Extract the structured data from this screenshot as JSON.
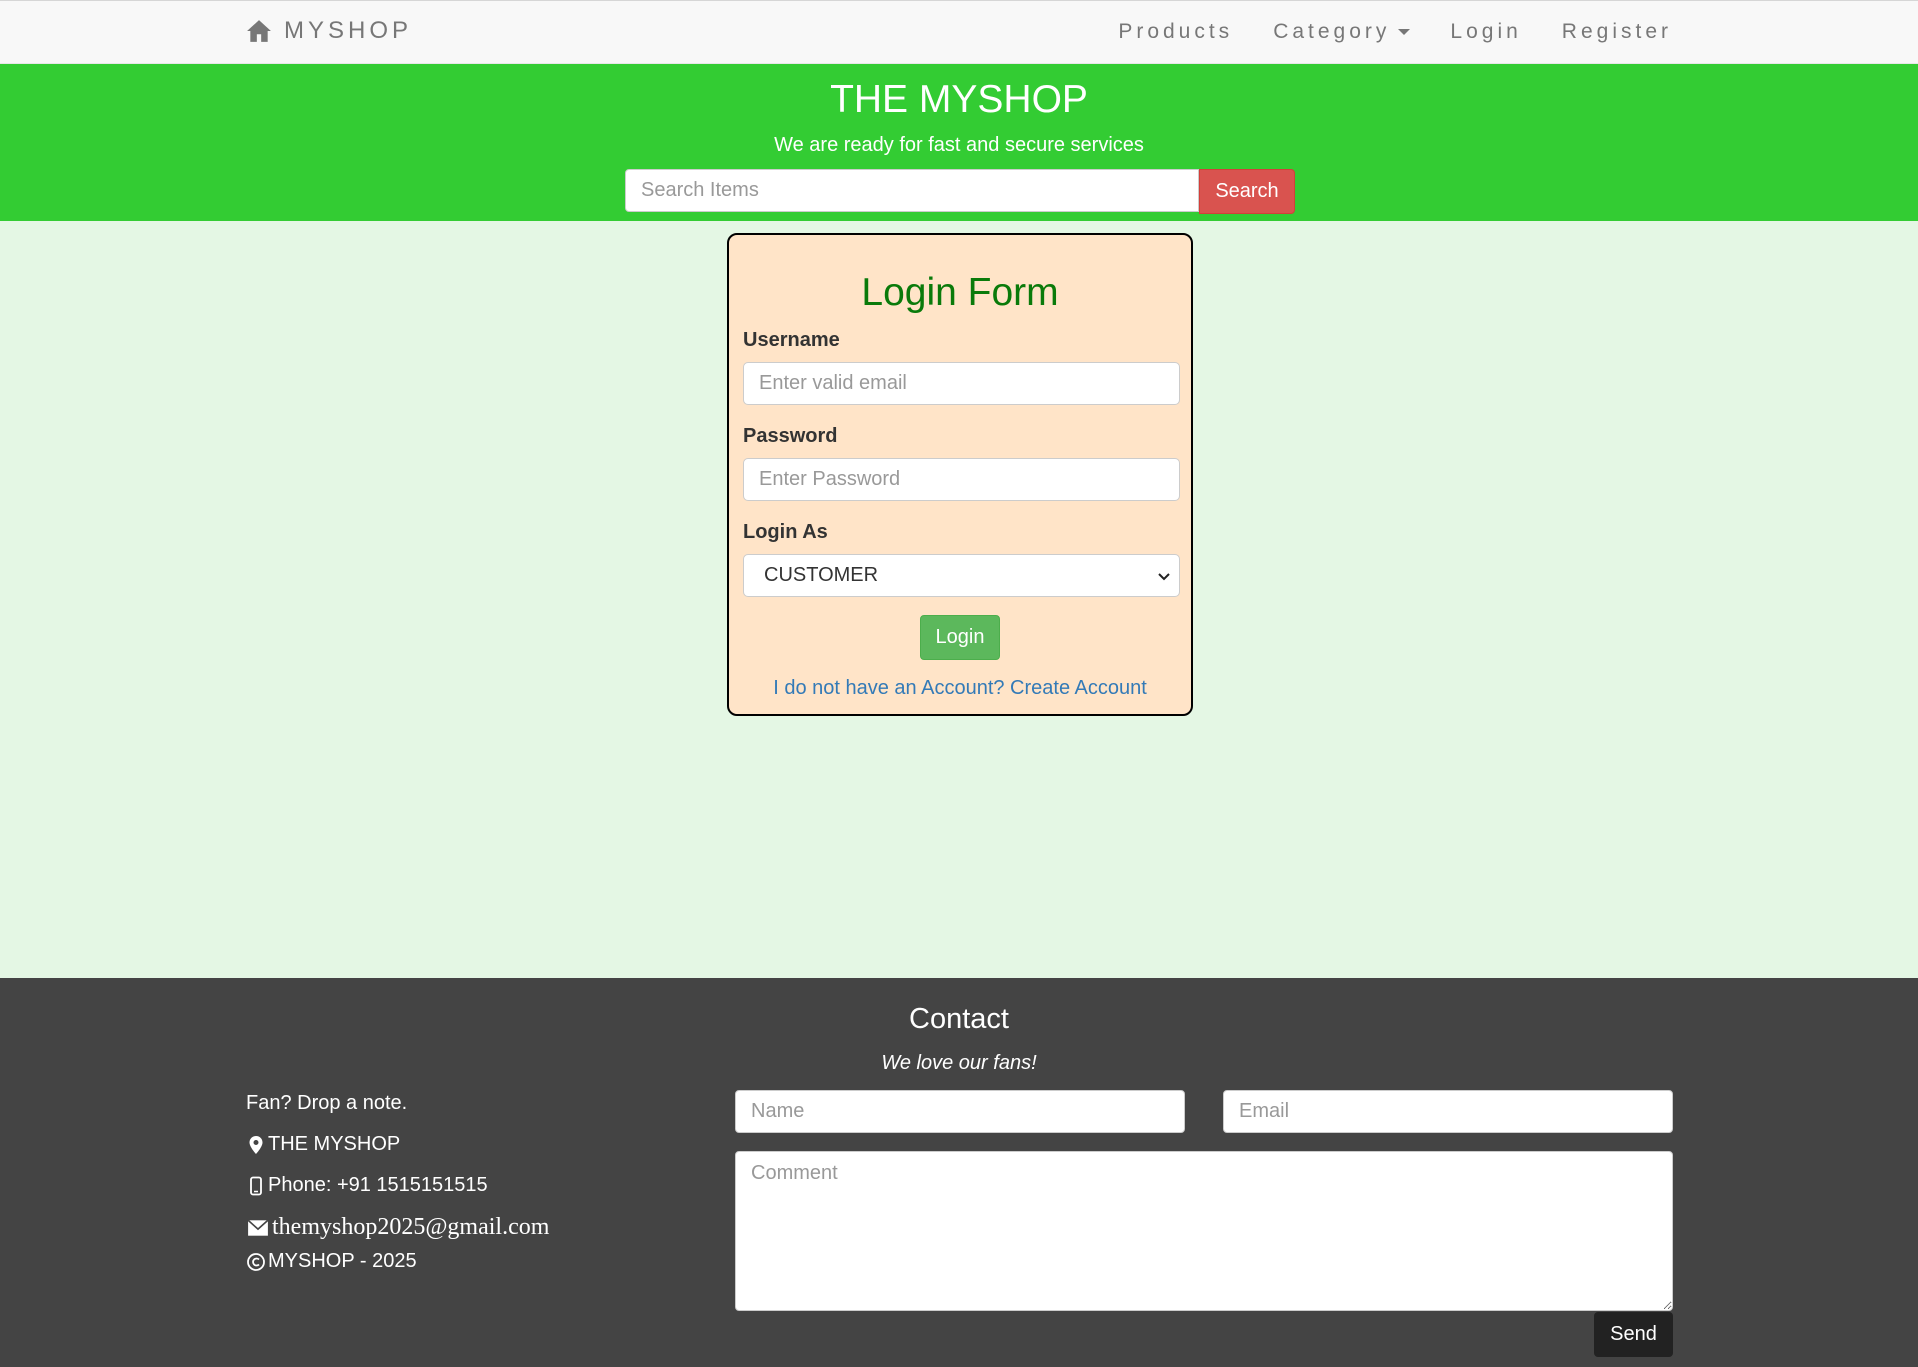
{
  "navbar": {
    "brand": "MYSHOP",
    "brand_icon": "home-icon",
    "links": {
      "products": "Products",
      "category": "Category",
      "login": "Login",
      "register": "Register"
    }
  },
  "hero": {
    "title": "THE MYSHOP",
    "subtitle": "We are ready for fast and secure services",
    "search_placeholder": "Search Items",
    "search_button": "Search",
    "background_color": "#33cc33"
  },
  "login_form": {
    "title": "Login Form",
    "username_label": "Username",
    "username_placeholder": "Enter valid email",
    "password_label": "Password",
    "password_placeholder": "Enter Password",
    "login_as_label": "Login As",
    "login_as_value": "CUSTOMER",
    "login_button": "Login",
    "create_account_link": "I do not have an Account? Create Account"
  },
  "footer": {
    "title": "Contact",
    "subtitle": "We love our fans!",
    "note": "Fan? Drop a note.",
    "address": "THE MYSHOP",
    "phone": "Phone: +91 1515151515",
    "email": "themyshop2025@gmail.com",
    "copyright": "MYSHOP - 2025",
    "name_placeholder": "Name",
    "email_placeholder": "Email",
    "comment_placeholder": "Comment",
    "send_button": "Send"
  }
}
